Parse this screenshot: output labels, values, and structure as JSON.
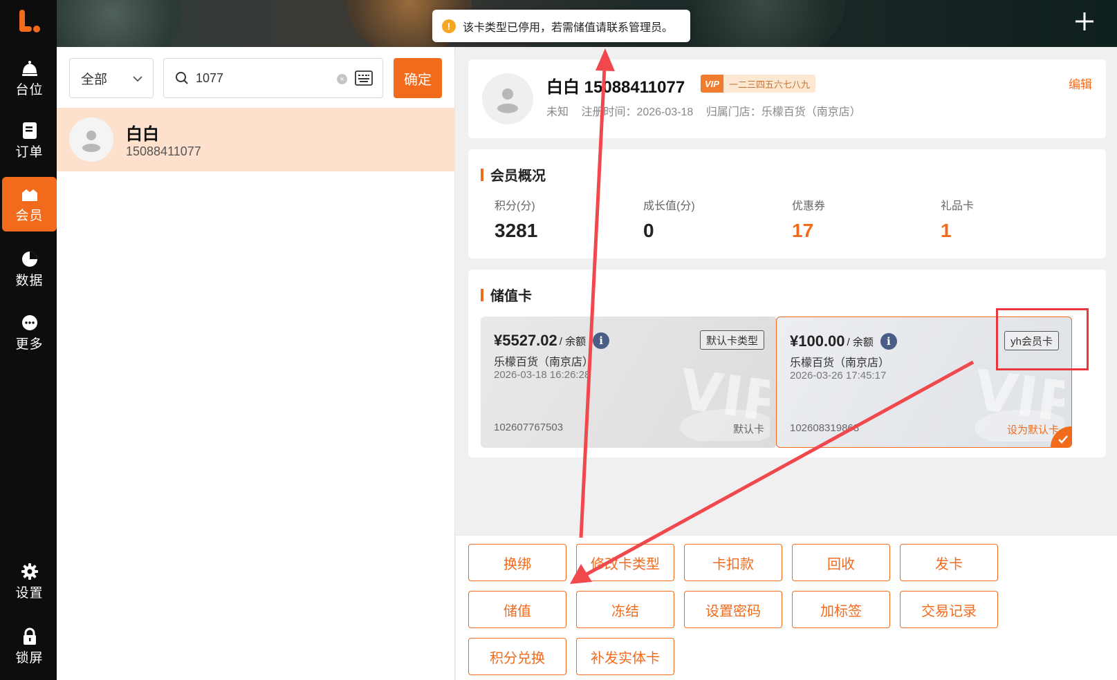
{
  "sidebar": {
    "items": [
      {
        "label": "台位",
        "icon": "bell-icon"
      },
      {
        "label": "订单",
        "icon": "document-icon"
      },
      {
        "label": "会员",
        "icon": "member-icon"
      },
      {
        "label": "数据",
        "icon": "pie-chart-icon"
      },
      {
        "label": "更多",
        "icon": "more-icon"
      },
      {
        "label": "设置",
        "icon": "gear-icon"
      },
      {
        "label": "锁屏",
        "icon": "lock-icon"
      }
    ],
    "active": "会员"
  },
  "toast": {
    "message": "该卡类型已停用，若需储值请联系管理员。"
  },
  "search": {
    "filter": "全部",
    "query": "1077",
    "confirm_label": "确定"
  },
  "member_list": [
    {
      "name": "白白",
      "phone": "15088411077"
    }
  ],
  "profile": {
    "name": "白白 15088411077",
    "vip_tag": "VIP",
    "vip_level": "一二三四五六七八九",
    "gender": "未知",
    "register": "注册时间：2026-03-18",
    "store": "归属门店：乐檬百货（南京店）",
    "edit_label": "编辑"
  },
  "overview": {
    "title": "会员概况",
    "stats": [
      {
        "label": "积分(分)",
        "value": "3281"
      },
      {
        "label": "成长值(分)",
        "value": "0"
      },
      {
        "label": "优惠券",
        "value": "17"
      },
      {
        "label": "礼品卡",
        "value": "1"
      }
    ]
  },
  "stored_value": {
    "title": "储值卡",
    "cards": [
      {
        "amount": "¥5527.02",
        "amount_suffix": "/ 余额",
        "store": "乐檬百货（南京店）",
        "date": "2026-03-18 16:26:28",
        "card_no": "102607767503",
        "type": "默认卡类型",
        "default": "默认卡"
      },
      {
        "amount": "¥100.00",
        "amount_suffix": "/ 余额",
        "store": "乐檬百货（南京店）",
        "date": "2026-03-26 17:45:17",
        "card_no": "102608319868",
        "type": "yh会员卡",
        "default": "设为默认卡"
      }
    ]
  },
  "actions": [
    "换绑",
    "修改卡类型",
    "卡扣款",
    "回收",
    "发卡",
    "储值",
    "冻结",
    "设置密码",
    "加标签",
    "交易记录",
    "积分兑换",
    "补发实体卡"
  ],
  "colors": {
    "accent": "#f26a1b",
    "annotation": "#e8383d"
  }
}
